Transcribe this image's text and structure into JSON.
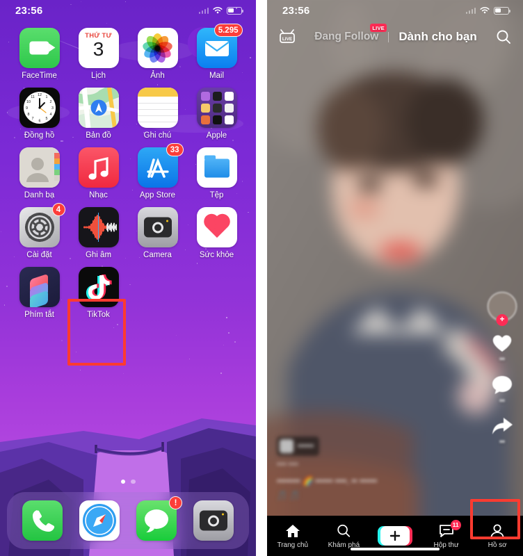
{
  "home_screen": {
    "status_bar": {
      "time": "23:56",
      "wifi_icon": "wifi-icon",
      "battery_icon": "battery-icon",
      "signal_icon": "signal-icon"
    },
    "apps": [
      {
        "label": "FaceTime",
        "icon": "facetime-icon",
        "badge": null
      },
      {
        "label": "Lịch",
        "icon": "calendar-icon",
        "badge": null,
        "weekday": "THỨ TƯ",
        "day": "3"
      },
      {
        "label": "Ảnh",
        "icon": "photos-icon",
        "badge": null
      },
      {
        "label": "Mail",
        "icon": "mail-icon",
        "badge": "5.295"
      },
      {
        "label": "Đồng hồ",
        "icon": "clock-icon",
        "badge": null
      },
      {
        "label": "Bản đồ",
        "icon": "maps-icon",
        "badge": null
      },
      {
        "label": "Ghi chú",
        "icon": "notes-icon",
        "badge": null
      },
      {
        "label": "Apple",
        "icon": "folder-icon",
        "badge": null
      },
      {
        "label": "Danh bạ",
        "icon": "contacts-icon",
        "badge": null
      },
      {
        "label": "Nhạc",
        "icon": "music-icon",
        "badge": null
      },
      {
        "label": "App Store",
        "icon": "appstore-icon",
        "badge": "33"
      },
      {
        "label": "Tệp",
        "icon": "files-icon",
        "badge": null
      },
      {
        "label": "Cài đặt",
        "icon": "settings-icon",
        "badge": "4"
      },
      {
        "label": "Ghi âm",
        "icon": "voice-memos-icon",
        "badge": null
      },
      {
        "label": "Camera",
        "icon": "camera-icon",
        "badge": null
      },
      {
        "label": "Sức khỏe",
        "icon": "health-icon",
        "badge": null
      },
      {
        "label": "Phím tắt",
        "icon": "shortcuts-icon",
        "badge": null
      },
      {
        "label": "TikTok",
        "icon": "tiktok-icon",
        "badge": null,
        "highlighted": true
      }
    ],
    "dock": [
      {
        "label": "Phone",
        "icon": "phone-icon",
        "badge": null
      },
      {
        "label": "Safari",
        "icon": "safari-icon",
        "badge": null
      },
      {
        "label": "Messages",
        "icon": "messages-icon",
        "badge": "!"
      },
      {
        "label": "Camera",
        "icon": "camera-icon",
        "badge": null
      }
    ],
    "page_dots": {
      "count": 2,
      "active_index": 0
    },
    "highlight_color": "#ff3b30"
  },
  "tiktok_screen": {
    "status_bar": {
      "time": "23:56",
      "wifi_icon": "wifi-icon",
      "battery_icon": "battery-icon",
      "signal_icon": "signal-icon"
    },
    "header": {
      "live_icon": "live-tv-icon",
      "tab_following": "Đang Follow",
      "following_badge": "LIVE",
      "tab_for_you": "Dành cho bạn",
      "active_tab": "Dành cho bạn",
      "search_icon": "search-icon"
    },
    "side_actions": [
      {
        "name": "avatar",
        "icon": "avatar-icon",
        "plus": "+",
        "count": ""
      },
      {
        "name": "like",
        "icon": "heart-icon",
        "count": "••"
      },
      {
        "name": "comment",
        "icon": "comment-icon",
        "count": "••"
      },
      {
        "name": "share",
        "icon": "share-icon",
        "count": "••"
      }
    ],
    "caption": {
      "author": "••••••",
      "subtitle": "••••  ••••",
      "text": "•••••••• 🌈 ••••••  ••••,  ••  ••••••",
      "emoji": "🎵 🎵"
    },
    "bottom_nav": [
      {
        "label": "Trang chủ",
        "icon": "home-icon",
        "badge": null,
        "active": true
      },
      {
        "label": "Khám phá",
        "icon": "search-icon",
        "badge": null,
        "active": false
      },
      {
        "label": "",
        "icon": "create-plus-icon",
        "badge": null,
        "active": false
      },
      {
        "label": "Hộp thư",
        "icon": "inbox-icon",
        "badge": "11",
        "active": false
      },
      {
        "label": "Hồ sơ",
        "icon": "profile-icon",
        "badge": null,
        "active": false,
        "highlighted": true
      }
    ],
    "highlight_color": "#ff3b30"
  },
  "colors": {
    "accent_red": "#ff3b30",
    "tiktok_pink": "#fe2c55",
    "tiktok_cyan": "#26f4ee",
    "badge_red": "#fc3d39"
  }
}
